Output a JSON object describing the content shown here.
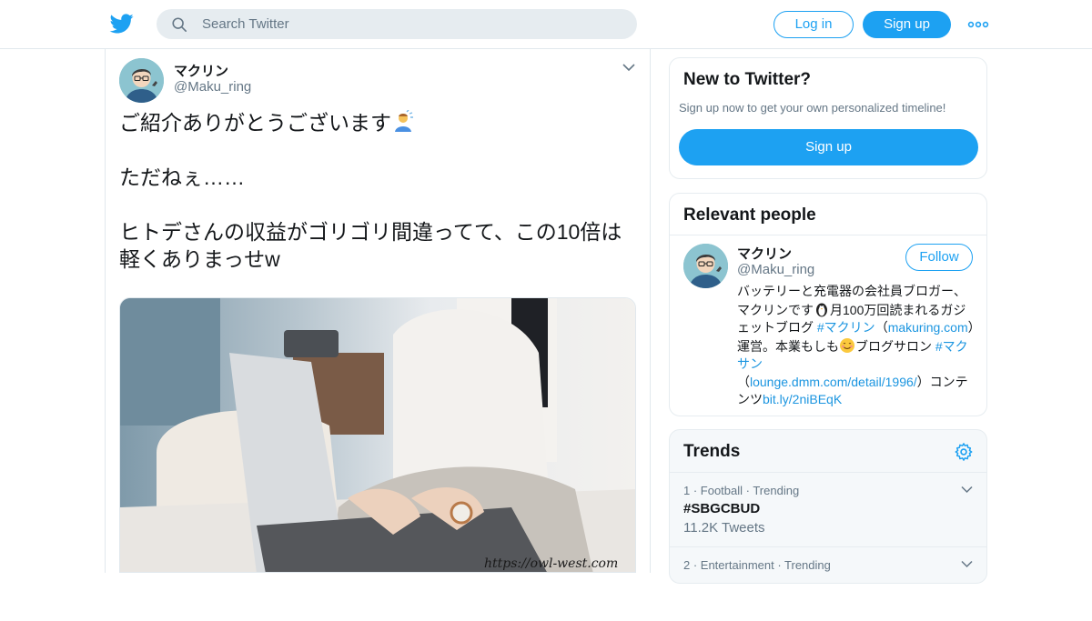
{
  "header": {
    "search_placeholder": "Search Twitter",
    "login_label": "Log in",
    "signup_label": "Sign up",
    "brand_color": "#1da1f2"
  },
  "tweet": {
    "author_name": "マクリン",
    "author_handle": "@Maku_ring",
    "line1": "ご紹介ありがとうございます",
    "line2": "ただねぇ……",
    "line3": "ヒトデさんの収益がゴリゴリ間違ってて、この10倍は軽くありまっせw",
    "media_watermark": "https://owl-west.com"
  },
  "new_to_twitter": {
    "title": "New to Twitter?",
    "subtitle": "Sign up now to get your own personalized timeline!",
    "button_label": "Sign up"
  },
  "relevant_people": {
    "title": "Relevant people",
    "name": "マクリン",
    "handle": "@Maku_ring",
    "follow_label": "Follow",
    "bio_part1": "バッテリーと充電器の会社員ブロガー、マクリンです",
    "bio_part2": "月100万回読まれるガジェットブログ",
    "bio_tag1": "#マクリン",
    "bio_part3": "（",
    "bio_link1": "makuring.com",
    "bio_part4": "）運営。本業もしも",
    "bio_part5": "ブログサロン",
    "bio_tag2": "#マクサン",
    "bio_part6": "（",
    "bio_link2": "lounge.dmm.com/detail/1996/",
    "bio_part7": "）コンテンツ",
    "bio_link3": "bit.ly/2niBEqK"
  },
  "trends": {
    "title": "Trends",
    "items": [
      {
        "meta": "1 · Football · Trending",
        "name": "#SBGCBUD",
        "count": "11.2K Tweets"
      },
      {
        "meta": "2 · Entertainment · Trending",
        "name": "",
        "count": ""
      }
    ]
  }
}
